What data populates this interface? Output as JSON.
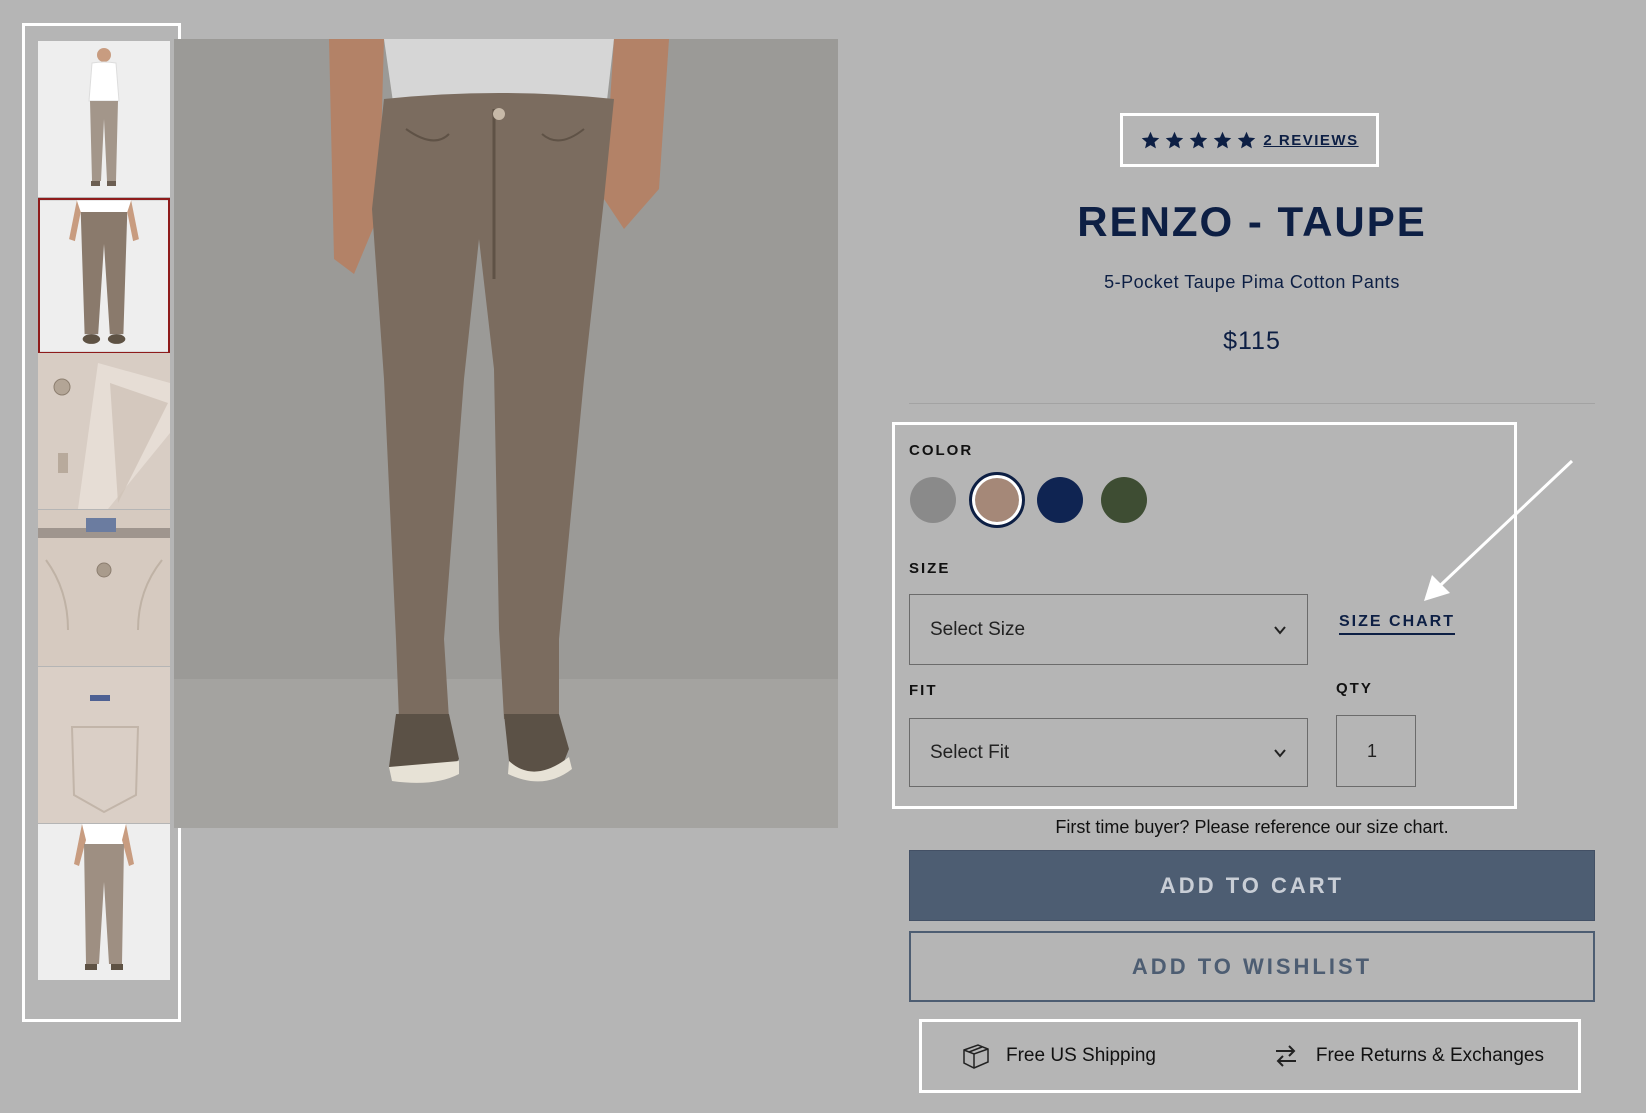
{
  "gallery": {
    "thumbnails": [
      {
        "name": "thumb-front-full-outfit",
        "selected": false
      },
      {
        "name": "thumb-front-pants",
        "selected": true
      },
      {
        "name": "thumb-fly-detail",
        "selected": false
      },
      {
        "name": "thumb-waistband-detail",
        "selected": false
      },
      {
        "name": "thumb-back-pocket-detail",
        "selected": false
      },
      {
        "name": "thumb-back-view",
        "selected": false
      }
    ]
  },
  "reviews": {
    "stars": 5,
    "label": "2 REVIEWS"
  },
  "product": {
    "title": "RENZO - TAUPE",
    "subtitle": "5-Pocket Taupe Pima Cotton Pants",
    "price": "$115"
  },
  "options": {
    "color_label": "COLOR",
    "colors": [
      {
        "name": "gray",
        "hex": "#8a8a8a",
        "selected": false
      },
      {
        "name": "taupe",
        "hex": "#a58878",
        "selected": true
      },
      {
        "name": "navy",
        "hex": "#0f2452",
        "selected": false
      },
      {
        "name": "olive",
        "hex": "#3e4d33",
        "selected": false
      }
    ],
    "size_label": "SIZE",
    "size_placeholder": "Select Size",
    "size_chart_link": "SIZE CHART",
    "fit_label": "FIT",
    "fit_placeholder": "Select Fit",
    "qty_label": "QTY",
    "qty_value": "1"
  },
  "hint": "First time buyer? Please reference our size chart.",
  "actions": {
    "add_to_cart": "ADD TO CART",
    "add_to_wishlist": "ADD TO WISHLIST"
  },
  "perks": {
    "shipping": {
      "icon": "box-icon",
      "label": "Free US Shipping"
    },
    "returns": {
      "icon": "exchange-arrows-icon",
      "label": "Free Returns & Exchanges"
    }
  }
}
